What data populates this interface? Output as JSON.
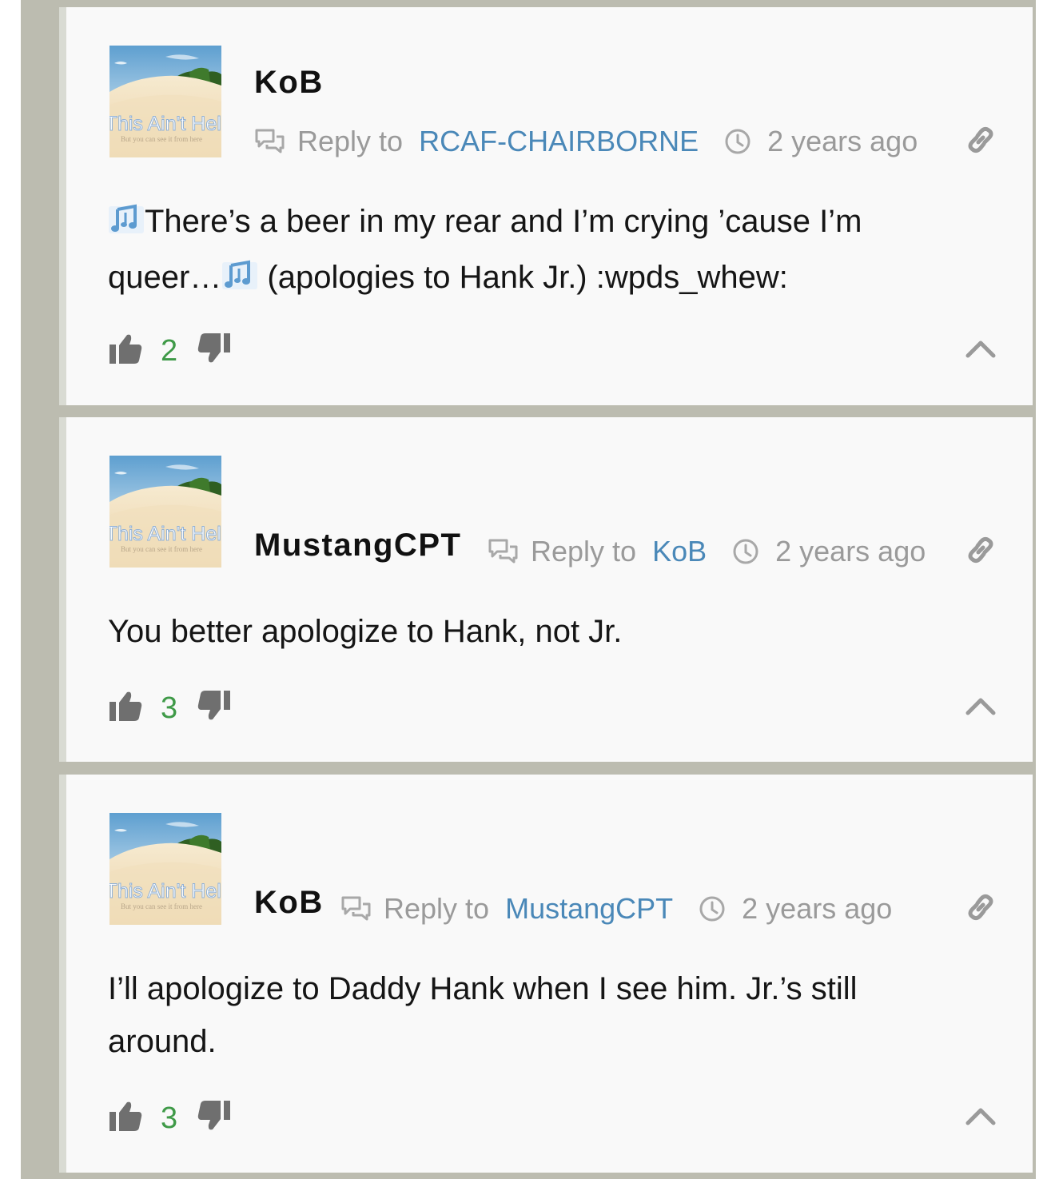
{
  "avatar": {
    "title": "This Ain't Hell",
    "subtitle": "But you can see it from here"
  },
  "comments": [
    {
      "author": "KoB",
      "reply_label": "Reply to",
      "reply_to": "RCAF-CHAIRBORNE",
      "time": "2 years ago",
      "text_a": "There’s a beer in my rear and I’m crying ’cause I’m queer…",
      "text_b": " (apologies to Hank Jr.) :wpds_whew:",
      "votes": "2"
    },
    {
      "author": "MustangCPT",
      "reply_label": "Reply to",
      "reply_to": "KoB",
      "time": "2 years ago",
      "text": "You better apologize to Hank, not Jr.",
      "votes": "3"
    },
    {
      "author": "KoB",
      "reply_label": "Reply to",
      "reply_to": "MustangCPT",
      "time": "2 years ago",
      "text": "I’ll apologize to Daddy Hank when I see him. Jr.’s still around.",
      "votes": "3"
    }
  ],
  "icons": {
    "reply": "reply-icon",
    "clock": "clock-icon",
    "link": "link-icon",
    "music": "music-note-icon",
    "upvote": "thumbs-up-icon",
    "downvote": "thumbs-down-icon",
    "collapse": "chevron-up-icon"
  },
  "colors": {
    "link_blue": "#4a88b8",
    "vote_green": "#3f9a48",
    "frame": "#bcbcb0",
    "card": "#f9f9f9"
  }
}
